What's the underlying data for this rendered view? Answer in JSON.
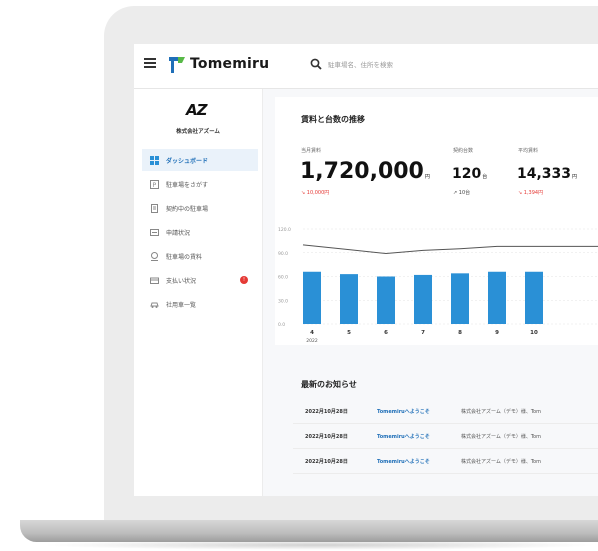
{
  "app": {
    "name": "Tomemiru"
  },
  "search": {
    "placeholder": "駐車場名、住所を検索"
  },
  "sidebar": {
    "company_logo": "AZ",
    "company_name": "株式会社アズーム",
    "items": [
      {
        "label": "ダッシュボード",
        "icon": "dashboard-icon",
        "active": true
      },
      {
        "label": "駐車場をさがす",
        "icon": "search-parking-icon"
      },
      {
        "label": "契約中の駐車場",
        "icon": "contract-icon"
      },
      {
        "label": "申請状況",
        "icon": "application-icon"
      },
      {
        "label": "駐車場の賃料",
        "icon": "rent-icon"
      },
      {
        "label": "支払い状況",
        "icon": "payment-icon",
        "badge": "!"
      },
      {
        "label": "社用車一覧",
        "icon": "car-icon"
      }
    ]
  },
  "dashboard": {
    "section_title": "賃料と台数の推移",
    "stats": [
      {
        "label": "当月賃料",
        "value": "1,720,000",
        "unit": "円",
        "delta": "↘ 10,000円",
        "delta_color": "#e53935"
      },
      {
        "label": "契約台数",
        "value": "120",
        "unit": "台",
        "delta": "↗ 10台",
        "delta_color": "#444444"
      },
      {
        "label": "平均賃料",
        "value": "14,333",
        "unit": "円",
        "delta": "↘ 1,394円",
        "delta_color": "#e53935"
      }
    ]
  },
  "chart_data": {
    "type": "bar",
    "categories": [
      "4",
      "5",
      "6",
      "7",
      "8",
      "9",
      "10"
    ],
    "x_sublabel": "2022",
    "series": [
      {
        "type": "bar",
        "values": [
          66,
          63,
          60,
          62,
          64,
          66,
          66
        ],
        "color": "#2a90d6"
      },
      {
        "type": "line",
        "values": [
          100,
          94,
          89,
          93,
          95,
          98,
          98
        ],
        "color": "#555555"
      }
    ],
    "y_tick_labels": [
      "0.0",
      "30.0",
      "60.0",
      "90.0",
      "120.0"
    ],
    "ylim": [
      0,
      120
    ],
    "grid": true
  },
  "news": {
    "title": "最新のお知らせ",
    "rows": [
      {
        "date": "2022月10月28日",
        "link": "Tomemiruへようこそ",
        "text": "株式会社アズーム（デモ）様、Tom"
      },
      {
        "date": "2022月10月28日",
        "link": "Tomemiruへようこそ",
        "text": "株式会社アズーム（デモ）様、Tom"
      },
      {
        "date": "2022月10月28日",
        "link": "Tomemiruへようこそ",
        "text": "株式会社アズーム（デモ）様、Tom"
      }
    ]
  },
  "colors": {
    "accent": "#2a90d6",
    "brand_green": "#58b947",
    "alert": "#e53935"
  }
}
